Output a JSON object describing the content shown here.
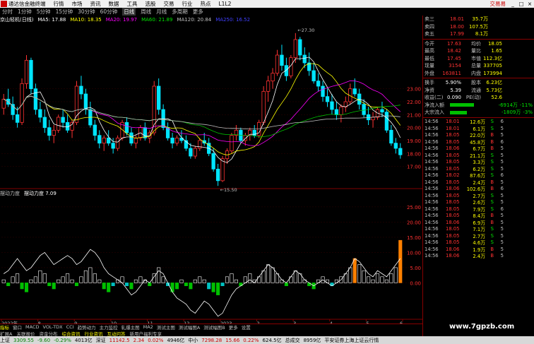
{
  "menubar": {
    "app_name": "通达信金融终端",
    "items": [
      "行情",
      "市场",
      "资讯",
      "数据",
      "工具",
      "选股",
      "交易",
      "行业",
      "热点",
      "L1L2"
    ],
    "trade_label": "交易易",
    "window_buttons": [
      "_",
      "□",
      "×"
    ]
  },
  "periods": {
    "items": [
      "分时",
      "1分钟",
      "5分钟",
      "15分钟",
      "30分钟",
      "60分钟",
      "日线",
      "周线",
      "月线",
      "多周期",
      "更多"
    ],
    "active": "日线"
  },
  "stock_title": "京山轻机(日线)",
  "ma_line": {
    "ma5": "MA5: 17.88",
    "ma10": "MA10: 18.35",
    "ma20": "MA20: 19.97",
    "ma60": "MA60: 21.89",
    "ma120": "MA120: 20.84",
    "ma250": "MA250: 16.52"
  },
  "colors": {
    "up": "#ff3232",
    "down": "#00e5ff",
    "ma5": "#ffffff",
    "ma10": "#ffff00",
    "ma20": "#ff00ff",
    "ma60": "#00c000",
    "ma120": "#c0c0c0",
    "ma250": "#0000ff",
    "grid": "#800000"
  },
  "chart_data": [
    {
      "type": "candlestick",
      "title": "京山轻机(日线)",
      "y_ticks": [
        "23.00",
        "22.00",
        "21.00",
        "20.00",
        "19.00",
        "18.00",
        "17.00"
      ],
      "ylim": [
        16.0,
        28.0
      ],
      "annotations": [
        {
          "text": "27.30",
          "kind": "high"
        },
        {
          "text": "15.50",
          "kind": "low"
        }
      ],
      "ohlc": [
        [
          21.5,
          22.6,
          21.0,
          22.2
        ],
        [
          22.2,
          23.0,
          21.6,
          21.8
        ],
        [
          21.8,
          22.4,
          20.6,
          21.0
        ],
        [
          21.0,
          21.6,
          20.0,
          20.4
        ],
        [
          20.4,
          23.8,
          20.2,
          23.4
        ],
        [
          23.4,
          25.6,
          23.0,
          25.2
        ],
        [
          25.2,
          25.4,
          22.6,
          23.0
        ],
        [
          23.0,
          23.4,
          21.0,
          21.4
        ],
        [
          21.4,
          22.0,
          20.4,
          20.8
        ],
        [
          20.8,
          21.4,
          19.6,
          20.0
        ],
        [
          20.0,
          20.6,
          19.0,
          19.4
        ],
        [
          19.4,
          20.2,
          18.8,
          19.8
        ],
        [
          19.8,
          21.0,
          19.6,
          20.8
        ],
        [
          20.8,
          21.4,
          20.0,
          20.4
        ],
        [
          20.4,
          21.0,
          19.6,
          19.8
        ],
        [
          19.8,
          20.6,
          19.2,
          20.4
        ],
        [
          20.4,
          23.6,
          20.2,
          23.2
        ],
        [
          23.2,
          24.0,
          22.2,
          22.6
        ],
        [
          22.6,
          23.0,
          21.0,
          21.4
        ],
        [
          21.4,
          22.0,
          20.0,
          20.2
        ],
        [
          20.2,
          20.6,
          19.0,
          19.4
        ],
        [
          19.4,
          19.8,
          18.4,
          18.8
        ],
        [
          18.8,
          19.4,
          18.2,
          19.2
        ],
        [
          19.2,
          19.8,
          18.6,
          18.8
        ],
        [
          18.8,
          19.2,
          18.0,
          18.4
        ],
        [
          18.4,
          19.4,
          18.2,
          19.2
        ],
        [
          19.2,
          20.6,
          19.0,
          20.4
        ],
        [
          20.4,
          20.8,
          19.4,
          19.6
        ],
        [
          19.6,
          20.0,
          18.6,
          18.8
        ],
        [
          18.8,
          19.4,
          18.4,
          19.2
        ],
        [
          19.2,
          20.2,
          19.0,
          20.0
        ],
        [
          20.0,
          20.4,
          19.0,
          19.2
        ],
        [
          19.2,
          19.8,
          18.8,
          19.6
        ],
        [
          19.6,
          23.6,
          19.4,
          23.2
        ],
        [
          23.2,
          23.8,
          21.0,
          21.4
        ],
        [
          21.4,
          21.8,
          19.8,
          20.0
        ],
        [
          20.0,
          20.4,
          19.0,
          19.2
        ],
        [
          19.2,
          19.6,
          18.4,
          18.8
        ],
        [
          18.8,
          19.4,
          18.6,
          19.2
        ],
        [
          19.2,
          19.8,
          18.8,
          19.0
        ],
        [
          19.0,
          19.4,
          18.2,
          18.4
        ],
        [
          18.4,
          18.8,
          17.6,
          17.8
        ],
        [
          17.8,
          18.6,
          17.6,
          18.4
        ],
        [
          18.4,
          19.2,
          18.2,
          19.0
        ],
        [
          19.0,
          19.6,
          18.6,
          18.8
        ],
        [
          18.8,
          19.2,
          17.8,
          18.0
        ],
        [
          18.0,
          18.4,
          16.6,
          16.8
        ],
        [
          16.8,
          17.2,
          15.5,
          15.9
        ],
        [
          15.9,
          17.8,
          15.8,
          17.6
        ],
        [
          17.6,
          18.4,
          17.2,
          18.2
        ],
        [
          18.2,
          19.6,
          18.0,
          19.4
        ],
        [
          19.4,
          20.2,
          19.0,
          19.8
        ],
        [
          19.8,
          20.0,
          18.8,
          19.0
        ],
        [
          19.0,
          19.6,
          18.6,
          19.4
        ],
        [
          19.4,
          20.0,
          19.0,
          19.8
        ],
        [
          19.8,
          20.2,
          19.2,
          19.4
        ],
        [
          19.4,
          20.6,
          19.2,
          20.4
        ],
        [
          20.4,
          23.2,
          20.2,
          22.8
        ],
        [
          22.8,
          24.0,
          22.0,
          23.6
        ],
        [
          23.6,
          24.6,
          23.0,
          24.2
        ],
        [
          24.2,
          26.0,
          24.0,
          25.6
        ],
        [
          25.6,
          26.4,
          24.4,
          24.8
        ],
        [
          24.8,
          25.4,
          23.6,
          24.0
        ],
        [
          24.0,
          25.6,
          23.8,
          25.4
        ],
        [
          25.4,
          27.3,
          25.0,
          26.8
        ],
        [
          26.8,
          27.0,
          25.2,
          25.6
        ],
        [
          25.6,
          26.2,
          24.6,
          25.0
        ],
        [
          25.0,
          25.8,
          24.0,
          24.4
        ],
        [
          24.4,
          25.0,
          23.4,
          23.6
        ],
        [
          23.6,
          24.2,
          22.8,
          23.2
        ],
        [
          23.2,
          23.6,
          22.0,
          22.4
        ],
        [
          22.4,
          23.0,
          21.6,
          22.0
        ],
        [
          22.0,
          22.6,
          21.0,
          21.4
        ],
        [
          21.4,
          22.0,
          20.6,
          21.0
        ],
        [
          21.0,
          21.8,
          20.4,
          21.6
        ],
        [
          21.6,
          22.4,
          21.2,
          22.0
        ],
        [
          22.0,
          23.4,
          21.8,
          23.0
        ],
        [
          23.0,
          23.8,
          22.4,
          22.6
        ],
        [
          22.6,
          23.0,
          21.4,
          21.8
        ],
        [
          21.8,
          22.2,
          20.8,
          21.0
        ],
        [
          21.0,
          21.6,
          20.2,
          20.6
        ],
        [
          20.6,
          21.2,
          20.0,
          20.8
        ],
        [
          20.8,
          21.6,
          20.6,
          21.4
        ],
        [
          21.4,
          22.0,
          20.8,
          21.2
        ],
        [
          21.2,
          21.4,
          19.6,
          19.8
        ],
        [
          19.8,
          20.2,
          18.6,
          18.8
        ],
        [
          18.8,
          19.2,
          18.0,
          18.4
        ],
        [
          18.4,
          18.8,
          17.6,
          17.9
        ]
      ]
    },
    {
      "type": "bar",
      "title": "摆动力度",
      "value_label": "摆动力度 7.09",
      "y_ticks": [
        "25.00",
        "20.00",
        "15.00",
        "10.00",
        "5.00",
        "0.00"
      ],
      "ylim": [
        -12,
        28
      ],
      "values": [
        1,
        -1,
        2,
        3,
        -2,
        -3,
        1,
        2,
        4,
        3,
        -1,
        -2,
        1,
        2,
        3,
        1,
        -1,
        2,
        4,
        5,
        3,
        1,
        -2,
        -3,
        -1,
        1,
        2,
        -1,
        -2,
        1,
        2,
        1,
        -1,
        3,
        5,
        2,
        -1,
        -3,
        -2,
        1,
        -1,
        -2,
        1,
        2,
        1,
        -2,
        -3,
        -4,
        -1,
        2,
        3,
        1,
        -1,
        2,
        3,
        1,
        2,
        4,
        6,
        5,
        3,
        1,
        -1,
        2,
        4,
        3,
        1,
        -1,
        -2,
        1,
        2,
        1,
        -1,
        1,
        2,
        3,
        5,
        8,
        6,
        4,
        2,
        1,
        3,
        2,
        1,
        3,
        5,
        14
      ],
      "line": [
        3,
        4,
        6,
        8,
        6,
        4,
        5,
        7,
        9,
        10,
        8,
        6,
        7,
        8,
        9,
        8,
        6,
        7,
        9,
        11,
        10,
        8,
        5,
        3,
        2,
        1,
        0,
        -2,
        -4,
        -3,
        -1,
        1,
        0,
        2,
        4,
        3,
        0,
        -3,
        -5,
        -6,
        -7,
        -9,
        -10,
        -8,
        -6,
        -7,
        -9,
        -11,
        -10,
        -7,
        -4,
        -2,
        -1,
        0,
        1,
        0,
        2,
        4,
        6,
        5,
        3,
        1,
        0,
        2,
        4,
        3,
        1,
        0,
        -1,
        0,
        1,
        0,
        -1,
        0,
        1,
        3,
        5,
        8,
        7,
        5,
        3,
        2,
        4,
        3,
        2,
        4,
        6,
        8
      ]
    }
  ],
  "x_axis_labels": [
    "2022年",
    "8",
    "9",
    "10",
    "11",
    "12",
    "2023",
    "2",
    "3",
    "4",
    "5",
    "6"
  ],
  "indicator_labels": {
    "vol_title": "摆动力度",
    "vol_value": "摆动力度 7.09"
  },
  "tabs": {
    "items": [
      "指标",
      "窗口",
      "MACD",
      "VOL-TDX",
      "CCI",
      "趋势动力",
      "主力监控",
      "轧爆主图",
      "MA2",
      "测试主图",
      "测试幅图A",
      "测试幅图B",
      "更多",
      "设置"
    ],
    "active": "指标"
  },
  "tabs2": {
    "items": [
      "扩展A",
      "关联报价",
      "资金分布",
      "综合资讯",
      "行业资讯",
      "互动问答",
      "新用户福利专享"
    ],
    "highlight": [
      "综合资讯",
      "行业资讯",
      "互动问答"
    ]
  },
  "order_book": {
    "sells": [
      {
        "label": "卖三",
        "price": "18.01",
        "vol": "35.7万"
      },
      {
        "label": "卖四",
        "price": "18.00",
        "vol": "107.5万"
      },
      {
        "label": "卖五",
        "price": "17.99",
        "vol": "8.1万"
      }
    ]
  },
  "quote": {
    "rows": [
      {
        "k1": "今开",
        "v1": "17.63",
        "k2": "均价",
        "v2": "18.05"
      },
      {
        "k1": "最高",
        "v1": "18.42",
        "k2": "量比",
        "v2": "1.65"
      },
      {
        "k1": "最低",
        "v1": "17.45",
        "k2": "市值",
        "v2": "112.3亿"
      },
      {
        "k1": "现量",
        "v1": "3154",
        "k2": "总量",
        "v2": "337705"
      },
      {
        "k1": "外盘",
        "v1": "163811",
        "k2": "内盘",
        "v2": "173994"
      }
    ],
    "rows2": [
      {
        "k1": "换手",
        "v1": "5.90%",
        "k2": "股本",
        "v2": "6.23亿"
      },
      {
        "k1": "净资",
        "v1": "5.39",
        "k2": "流通",
        "v2": "5.73亿"
      },
      {
        "k1": "收益(二)",
        "v1": "0.090",
        "k2": "PE(动)",
        "v2": "52.6"
      }
    ],
    "flows": [
      {
        "label": "净流入额",
        "value": "-6914万",
        "pct": "-11%"
      },
      {
        "label": "大宗流入",
        "value": "-1809万",
        "pct": "-3%"
      }
    ]
  },
  "ticks": [
    {
      "t": "14:56",
      "p": "18.01",
      "v": "12.6万",
      "d": "S",
      "n": "6"
    },
    {
      "t": "14:56",
      "p": "18.01",
      "v": "6.1万",
      "d": "S",
      "n": "5"
    },
    {
      "t": "14:56",
      "p": "18.05",
      "v": "22.0万",
      "d": "B",
      "n": "5"
    },
    {
      "t": "14:56",
      "p": "18.05",
      "v": "45.8万",
      "d": "B",
      "n": "6"
    },
    {
      "t": "14:56",
      "p": "18.06",
      "v": "6.7万",
      "d": "B",
      "n": "5"
    },
    {
      "t": "14:56",
      "p": "18.05",
      "v": "21.1万",
      "d": "S",
      "n": "5"
    },
    {
      "t": "14:56",
      "p": "18.05",
      "v": "3.3万",
      "d": "S",
      "n": "5"
    },
    {
      "t": "14:56",
      "p": "18.05",
      "v": "6.2万",
      "d": "S",
      "n": "5"
    },
    {
      "t": "14:56",
      "p": "18.02",
      "v": "87.6万",
      "d": "S",
      "n": "6"
    },
    {
      "t": "14:56",
      "p": "18.05",
      "v": "2.4万",
      "d": "B",
      "n": "5"
    },
    {
      "t": "14:56",
      "p": "18.06",
      "v": "102.6万",
      "d": "B",
      "n": "6"
    },
    {
      "t": "14:56",
      "p": "18.05",
      "v": "2.7万",
      "d": "S",
      "n": "5"
    },
    {
      "t": "14:56",
      "p": "18.05",
      "v": "2.6万",
      "d": "S",
      "n": "5"
    },
    {
      "t": "14:56",
      "p": "18.05",
      "v": "7.9万",
      "d": "S",
      "n": "6"
    },
    {
      "t": "14:56",
      "p": "18.05",
      "v": "8.4万",
      "d": "B",
      "n": "5"
    },
    {
      "t": "14:56",
      "p": "18.06",
      "v": "6.9万",
      "d": "B",
      "n": "5"
    },
    {
      "t": "14:56",
      "p": "18.05",
      "v": "7.1万",
      "d": "S",
      "n": "5"
    },
    {
      "t": "14:56",
      "p": "18.05",
      "v": "2.7万",
      "d": "S",
      "n": "5"
    },
    {
      "t": "14:56",
      "p": "18.05",
      "v": "4.6万",
      "d": "S",
      "n": "5"
    },
    {
      "t": "14:56",
      "p": "18.06",
      "v": "1.9万",
      "d": "B",
      "n": "5"
    },
    {
      "t": "14:56",
      "p": "18.06",
      "v": "2.4万",
      "d": "B",
      "n": "5"
    }
  ],
  "bottombar": {
    "idx1_name": "上证",
    "idx1_val": "3309.55",
    "idx1_chg": "-9.60",
    "idx1_pct": "-0.29%",
    "idx1_amt": "4013亿",
    "idx2_name": "深证",
    "idx2_val": "11142.5",
    "idx2_chg": "2.34",
    "idx2_pct": "0.02%",
    "idx2_amt": "4946亿",
    "idx3_name": "中小",
    "idx3_val": "7298.28",
    "idx3_chg": "15.66",
    "idx3_pct": "0.22%",
    "idx3_amt": "624.5亿",
    "idx4_name": "总成交",
    "idx4_val": "8959亿",
    "server": "平安证券上海上证云行情"
  },
  "watermark": "www.7gpzb.com"
}
